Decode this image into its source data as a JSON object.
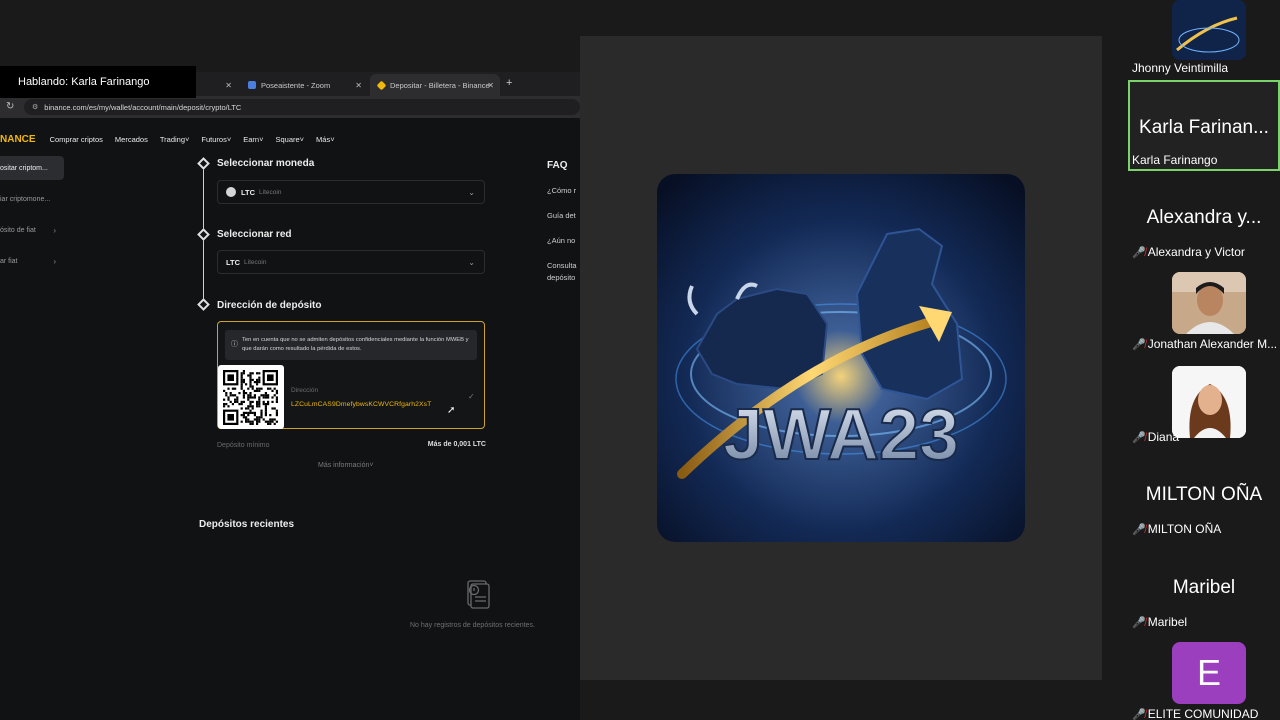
{
  "speaking_banner": "Hablando: Karla Farinango",
  "browser": {
    "tabs": [
      {
        "label": "",
        "icon": "blank-tab-icon"
      },
      {
        "label": "Poseaistente - Zoom",
        "icon": "zoom-icon"
      },
      {
        "label": "Depositar - Billetera - Binance",
        "icon": "binance-icon"
      }
    ],
    "new_tab": "+",
    "url": "binance.com/es/my/wallet/account/main/deposit/crypto/LTC"
  },
  "binance": {
    "logo_text": "NANCE",
    "nav": [
      "Comprar criptos",
      "Mercados",
      "Trading",
      "Futuros",
      "Earn",
      "Square",
      "Más"
    ],
    "sidebar": [
      {
        "label": "ositar criptom...",
        "active": true
      },
      {
        "label": "iar criptomone...",
        "active": false
      },
      {
        "label": "ósito de fiat",
        "active": false
      },
      {
        "label": "ar fiat",
        "active": false
      }
    ],
    "step1": {
      "title": "Seleccionar moneda",
      "code": "LTC",
      "name": "Litecoin"
    },
    "step2": {
      "title": "Seleccionar red",
      "code": "LTC",
      "name": "Litecoin"
    },
    "step3": {
      "title": "Dirección de depósito",
      "notice": "Ten en cuenta que no se admiten depósitos confidenciales mediante la función MWEB y que darán como resultado la pérdida de estos.",
      "address_label": "Dirección",
      "address_value": "LZCuLmCAS9DmefybwsKCWVCRfgarh2XsT"
    },
    "min_deposit_label": "Depósito mínimo",
    "min_deposit_value": "Más de 0,001 LTC",
    "more_info": "Más información",
    "recent_title": "Depósitos recientes",
    "recent_empty": "No hay registros de depósitos recientes.",
    "faq": {
      "title": "FAQ",
      "items": [
        "¿Cómo r",
        "Guía det",
        "¿Aún no",
        "Consulta",
        "depósito"
      ]
    }
  },
  "main_video": {
    "logo_text": "JWA23"
  },
  "participants": [
    {
      "name": "Jhonny Veintimilla",
      "muted": false
    },
    {
      "big": "Karla Farinan...",
      "name": "Karla Farinango",
      "muted": false,
      "active": true
    },
    {
      "big": "Alexandra y...",
      "name": "Alexandra y Victor",
      "muted": true
    },
    {
      "name": "Jonathan Alexander M...",
      "muted": true
    },
    {
      "name": "Diana",
      "muted": true
    },
    {
      "big": "MILTON OÑA",
      "name": "MILTON OÑA",
      "muted": true
    },
    {
      "big": "Maribel",
      "name": "Maribel",
      "muted": true
    },
    {
      "avatar_letter": "E",
      "name": "ELITE COMUNIDAD",
      "muted": true
    }
  ],
  "colors": {
    "binance_yellow": "#f0b90b",
    "active_speaker": "#7ad36b",
    "muted_red": "#d32f2f"
  }
}
